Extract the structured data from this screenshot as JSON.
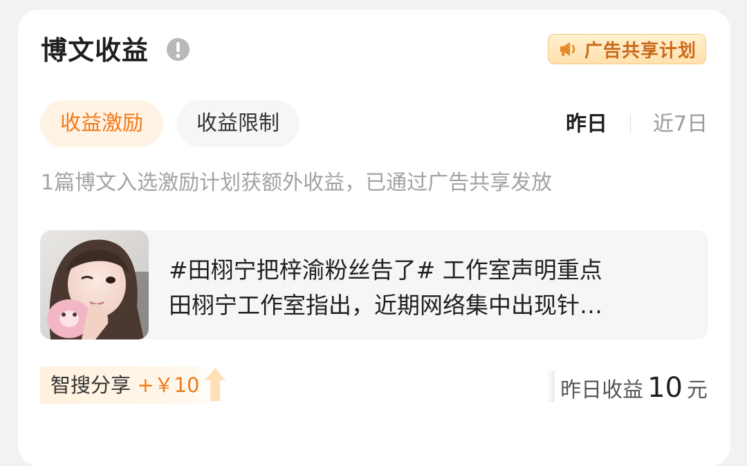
{
  "header": {
    "title": "博文收益",
    "ad_badge_label": "广告共享计划"
  },
  "tabs": [
    {
      "label": "收益激励",
      "active": true
    },
    {
      "label": "收益限制",
      "active": false
    }
  ],
  "period": {
    "yesterday": "昨日",
    "last7": "近7日",
    "selected": "昨日"
  },
  "notice": "1篇博文入选激励计划获额外收益，已通过广告共享发放",
  "post": {
    "line1": "#田栩宁把梓渝粉丝告了# 工作室声明重点",
    "line2": "田栩宁工作室指出，近期网络集中出现针…"
  },
  "reward": {
    "label": "智搜分享",
    "amount": "+￥10"
  },
  "earnings": {
    "label": "昨日收益",
    "value": "10",
    "unit": "元"
  },
  "colors": {
    "accent": "#f27a16",
    "badge_text": "#c86a1c"
  },
  "icons": {
    "info": "info-icon",
    "megaphone": "megaphone-icon",
    "arrow": "arrow-up-icon"
  }
}
